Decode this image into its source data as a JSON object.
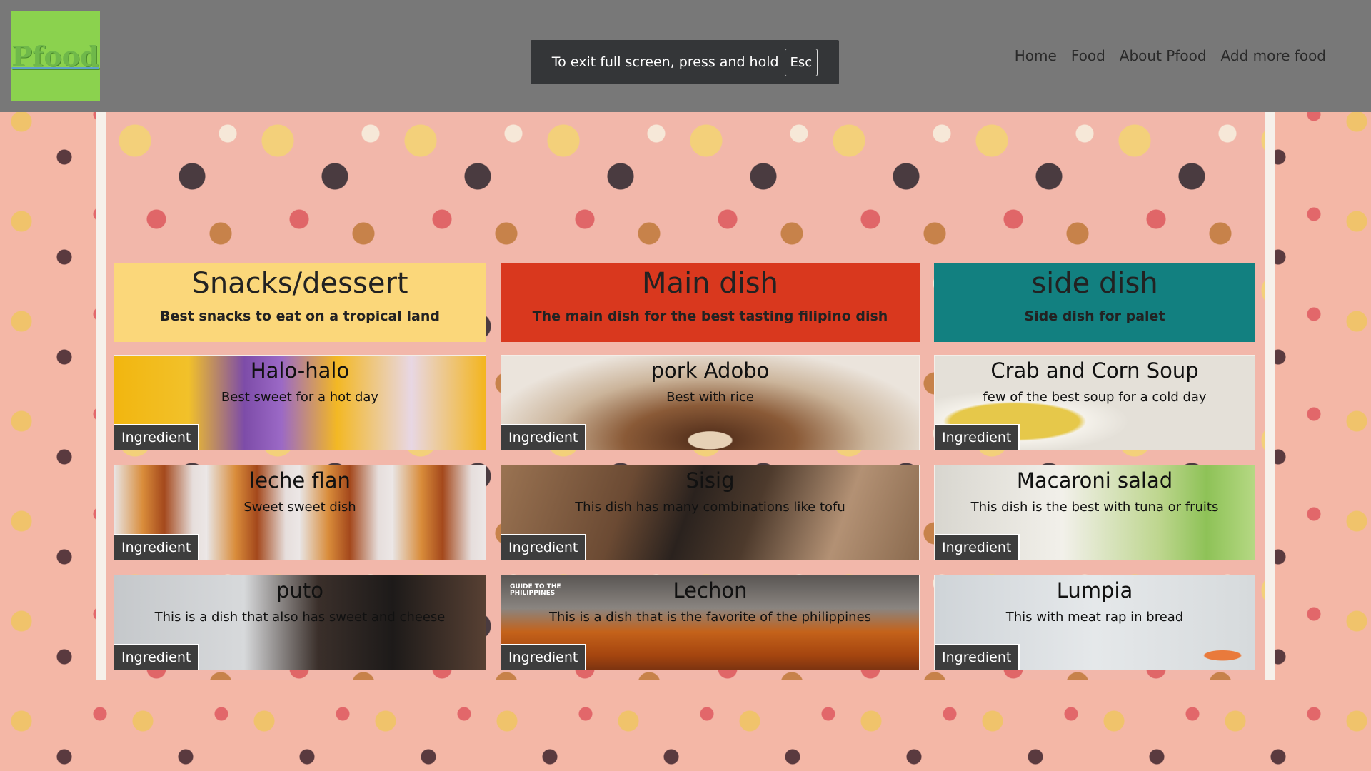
{
  "colors": {
    "navbar": "#787878",
    "logo_bg": "#8bd24e",
    "snacks_header": "#fbd77a",
    "main_header": "#d9381e",
    "side_header": "#128080",
    "ingredient_button": "#3d3d3d"
  },
  "nav": {
    "logo_text": "Pfood",
    "links": [
      "Home",
      "Food",
      "About Pfood",
      "Add more food"
    ]
  },
  "fullscreen_toast": {
    "message": "To exit full screen, press and hold",
    "key": "Esc"
  },
  "columns": [
    {
      "title": "Snacks/dessert",
      "subtitle": "Best snacks to eat on a tropical land",
      "items": [
        {
          "name": "Halo-halo",
          "desc": "Best sweet for a hot day",
          "button": "Ingredient"
        },
        {
          "name": "leche flan",
          "desc": "Sweet sweet dish",
          "button": "Ingredient"
        },
        {
          "name": "puto",
          "desc": "This is a dish that also has sweet and cheese",
          "button": "Ingredient"
        }
      ]
    },
    {
      "title": "Main dish",
      "subtitle": "The main dish for the best tasting filipino dish",
      "items": [
        {
          "name": "pork Adobo",
          "desc": "Best with rice",
          "button": "Ingredient"
        },
        {
          "name": "Sisig",
          "desc": "This dish has many combinations like tofu",
          "button": "Ingredient"
        },
        {
          "name": "Lechon",
          "desc": "This is a dish that is the favorite of the philippines",
          "button": "Ingredient",
          "badge": "GUIDE TO THE PHILIPPINES"
        }
      ]
    },
    {
      "title": "side dish",
      "subtitle": "Side dish for palet",
      "items": [
        {
          "name": "Crab and Corn Soup",
          "desc": "few of the best soup for a cold day",
          "button": "Ingredient"
        },
        {
          "name": "Macaroni salad",
          "desc": "This dish is the best with tuna or fruits",
          "button": "Ingredient"
        },
        {
          "name": "Lumpia",
          "desc": "This with meat rap in bread",
          "button": "Ingredient"
        }
      ]
    }
  ]
}
